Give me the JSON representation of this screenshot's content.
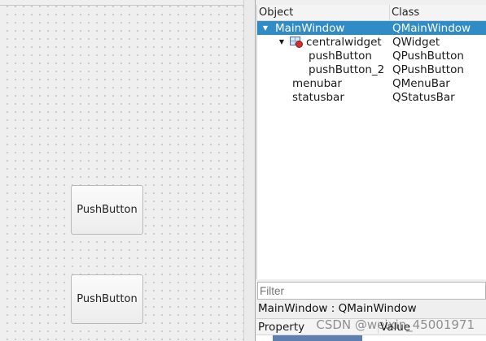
{
  "canvas": {
    "buttons": [
      {
        "label": "PushButton"
      },
      {
        "label": "PushButton"
      }
    ]
  },
  "object_inspector": {
    "columns": {
      "object": "Object",
      "class": "Class"
    },
    "rows": [
      {
        "object": "MainWindow",
        "class": "QMainWindow",
        "level": 0,
        "expanded": true,
        "selected": true
      },
      {
        "object": "centralwidget",
        "class": "QWidget",
        "level": 1,
        "expanded": true,
        "icon": "broken-layout-widget-icon"
      },
      {
        "object": "pushButton",
        "class": "QPushButton",
        "level": 2
      },
      {
        "object": "pushButton_2",
        "class": "QPushButton",
        "level": 2
      },
      {
        "object": "menubar",
        "class": "QMenuBar",
        "level": 1
      },
      {
        "object": "statusbar",
        "class": "QStatusBar",
        "level": 1
      }
    ]
  },
  "property_editor": {
    "filter_placeholder": "Filter",
    "title": "MainWindow : QMainWindow",
    "columns": {
      "property": "Property",
      "value": "Value"
    }
  },
  "watermark": "CSDN @weixin_45001971",
  "colors": {
    "selection": "#308cc6",
    "canvas_bg": "#efefef"
  }
}
